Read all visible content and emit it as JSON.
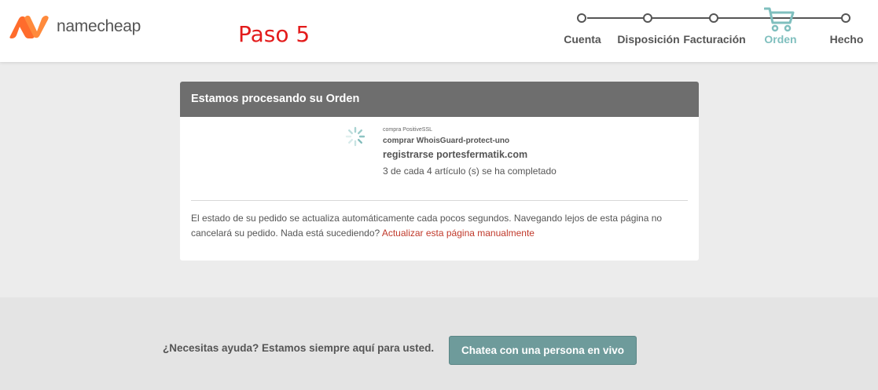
{
  "header": {
    "logo_text": "namecheap",
    "step_title": "Paso 5",
    "steps": [
      {
        "label": "Cuenta",
        "active": false
      },
      {
        "label": "Disposición",
        "active": false
      },
      {
        "label": "Facturación",
        "active": false
      },
      {
        "label": "Orden",
        "active": true
      },
      {
        "label": "Hecho",
        "active": false
      }
    ],
    "colors": {
      "brand": "#ff6c2c",
      "step_title": "#e31b1b",
      "active_step": "#7fbfbe"
    }
  },
  "processing": {
    "title": "Estamos procesando su Orden",
    "items": [
      "compra PositiveSSL",
      "comprar WhoisGuard-protect-uno",
      "registrarse portesfermatik.com"
    ],
    "status": "3 de cada 4 artículo (s) se ha completado",
    "note": "El estado de su pedido se actualiza automáticamente cada pocos segundos. Navegando lejos de esta página no cancelará su pedido. Nada está sucediendo?",
    "refresh_link": "Actualizar esta página manualmente"
  },
  "footer": {
    "help_text": "¿Necesitas ayuda? Estamos siempre aquí para usted.",
    "chat_button": "Chatea con una persona en vivo"
  }
}
